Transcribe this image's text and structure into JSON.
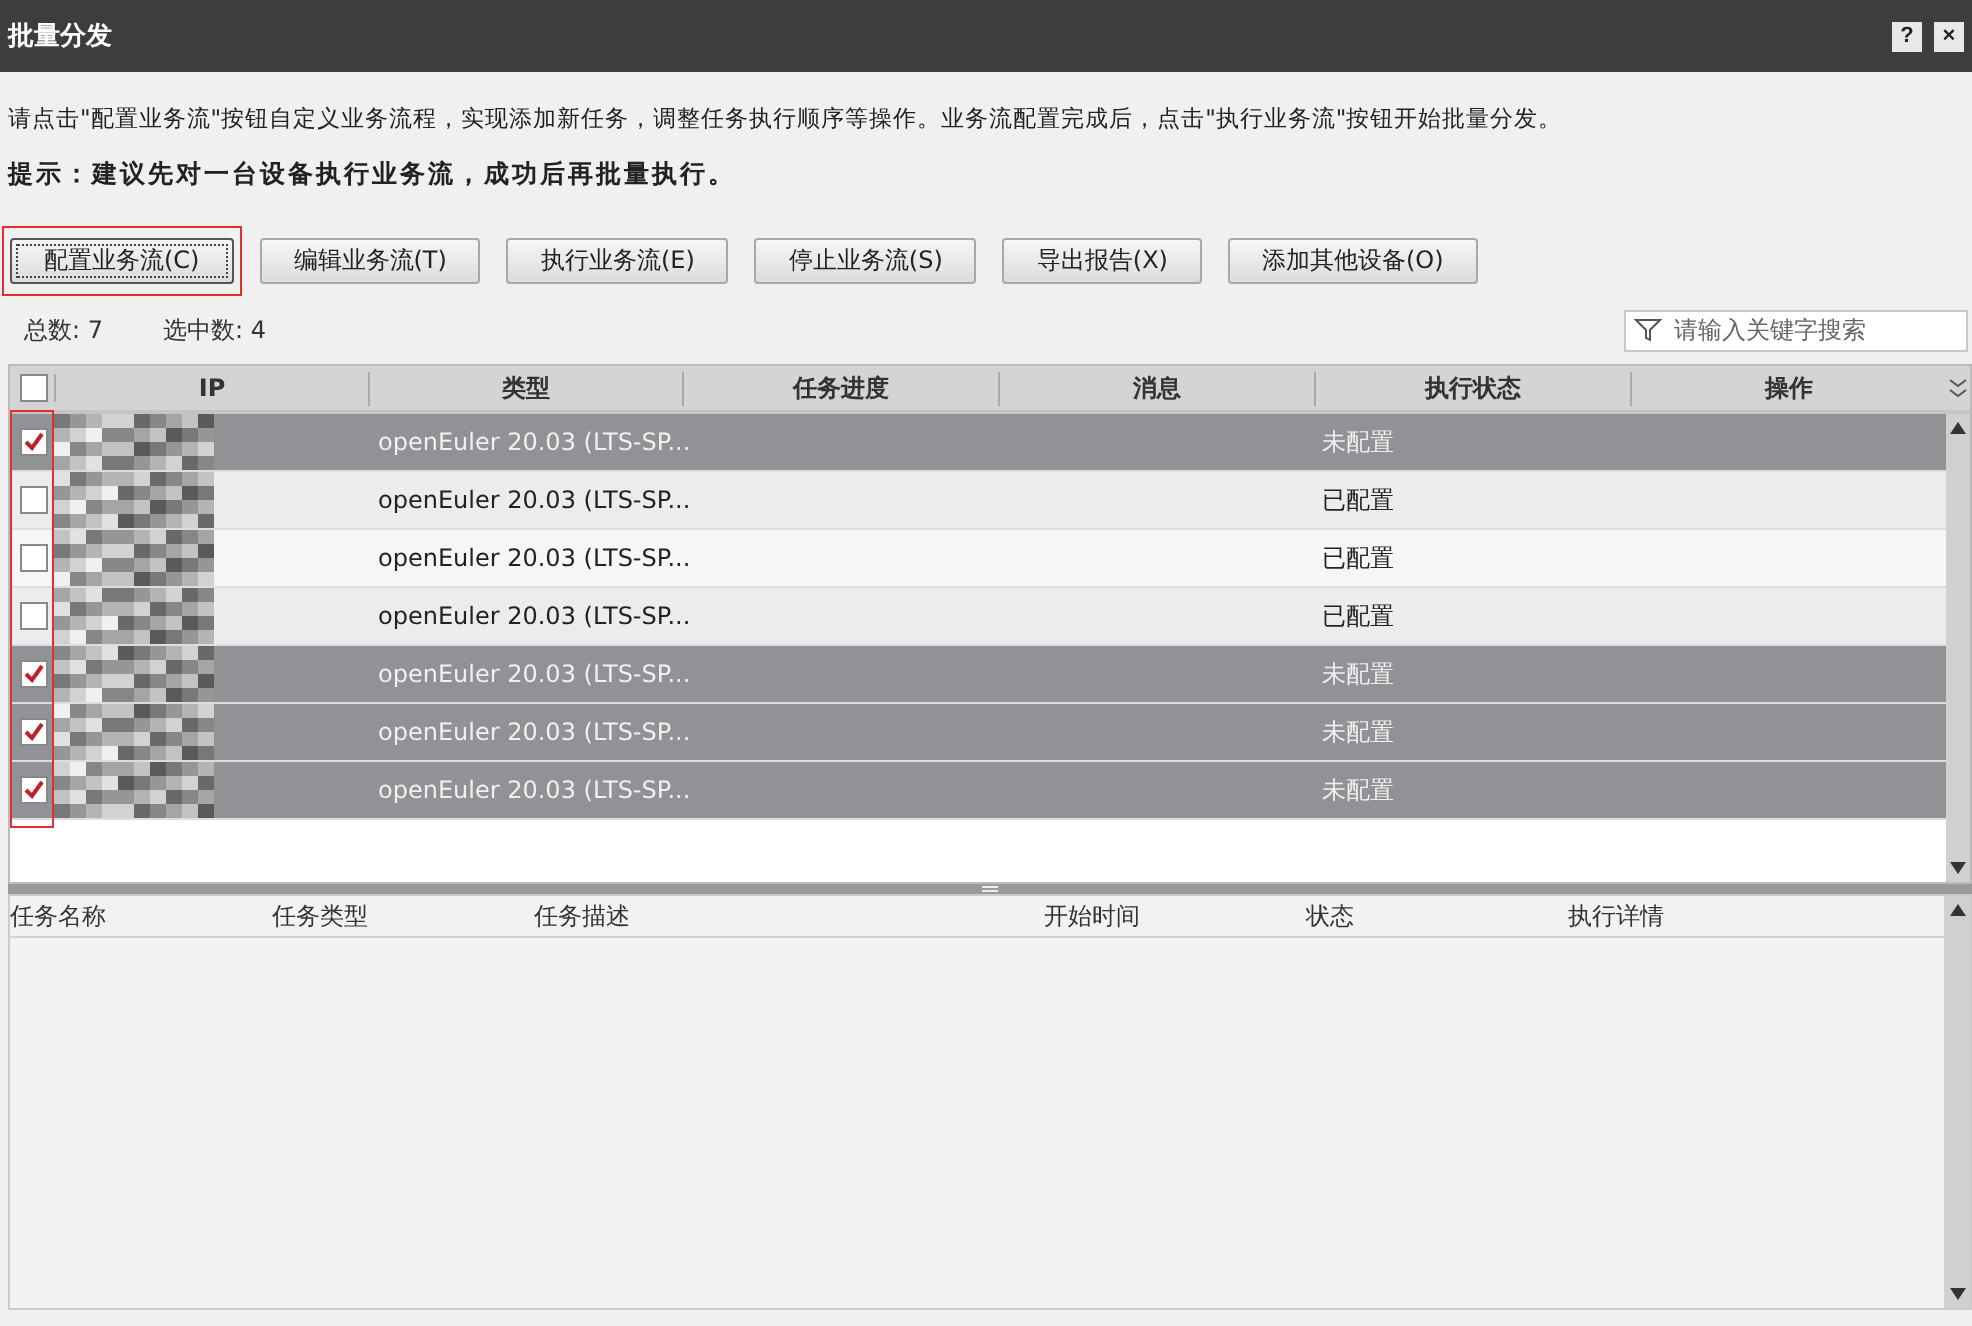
{
  "window": {
    "title": "批量分发",
    "help_label": "?",
    "close_label": "×"
  },
  "instructions": "请点击\"配置业务流\"按钮自定义业务流程，实现添加新任务，调整任务执行顺序等操作。业务流配置完成后，点击\"执行业务流\"按钮开始批量分发。",
  "tip": "提示：建议先对一台设备执行业务流，成功后再批量执行。",
  "buttons": [
    {
      "label": "配置业务流(C)",
      "focused": true,
      "highlighted": true
    },
    {
      "label": "编辑业务流(T)",
      "focused": false,
      "highlighted": false
    },
    {
      "label": "执行业务流(E)",
      "focused": false,
      "highlighted": false
    },
    {
      "label": "停止业务流(S)",
      "focused": false,
      "highlighted": false
    },
    {
      "label": "导出报告(X)",
      "focused": false,
      "highlighted": false
    },
    {
      "label": "添加其他设备(O)",
      "focused": false,
      "highlighted": false
    }
  ],
  "counts": {
    "total": "总数: 7",
    "selected": "选中数: 4"
  },
  "search": {
    "placeholder": "请输入关键字搜索"
  },
  "device_table": {
    "select_all_checked": false,
    "checkbox_column_highlighted": true,
    "columns": [
      "IP",
      "类型",
      "任务进度",
      "消息",
      "执行状态",
      "操作"
    ],
    "rows": [
      {
        "checked": true,
        "type": "openEuler 20.03 (LTS-SP...",
        "status": "未配置"
      },
      {
        "checked": false,
        "type": "openEuler 20.03 (LTS-SP...",
        "status": "已配置"
      },
      {
        "checked": false,
        "type": "openEuler 20.03 (LTS-SP...",
        "status": "已配置"
      },
      {
        "checked": false,
        "type": "openEuler 20.03 (LTS-SP...",
        "status": "已配置"
      },
      {
        "checked": true,
        "type": "openEuler 20.03 (LTS-SP...",
        "status": "未配置"
      },
      {
        "checked": true,
        "type": "openEuler 20.03 (LTS-SP...",
        "status": "未配置"
      },
      {
        "checked": true,
        "type": "openEuler 20.03 (LTS-SP...",
        "status": "未配置"
      }
    ]
  },
  "task_table": {
    "columns": [
      "任务名称",
      "任务类型",
      "任务描述",
      "开始时间",
      "状态",
      "执行详情"
    ]
  }
}
